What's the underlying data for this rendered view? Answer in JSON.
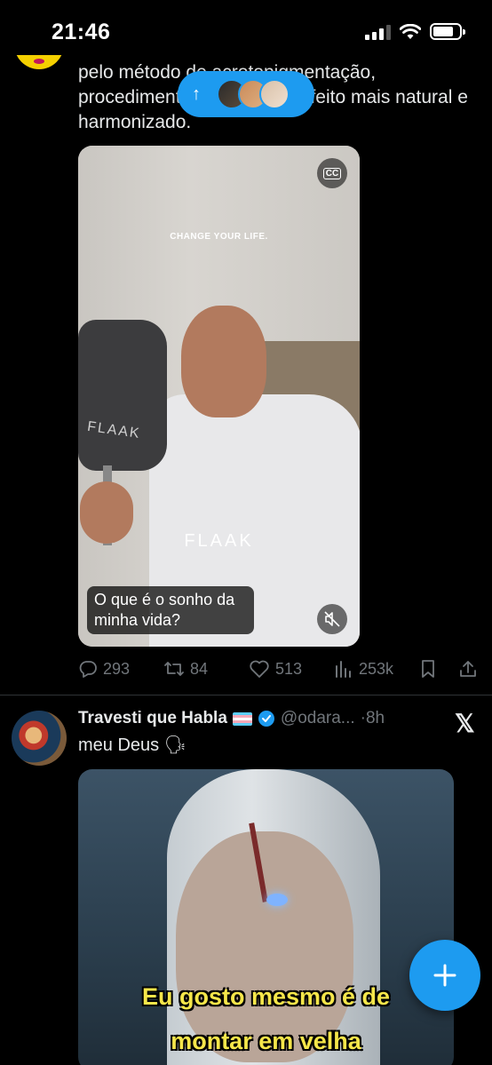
{
  "status_bar": {
    "time": "21:46",
    "signal_icon": "signal-icon",
    "wifi_icon": "wifi-icon",
    "battery_icon": "battery-icon"
  },
  "new_posts_pill": {
    "icon": "arrow-up-icon"
  },
  "tweet1": {
    "text": "pelo método de acrotopigmentação, procedimento que traz um efeito mais natural e harmonizado.",
    "video": {
      "tagline": "CHANGE YOUR LIFE.",
      "brand": "FLAAK",
      "mirror_brand": "FLAAK",
      "caption": "O que é o sonho da minha vida?",
      "cc_label": "CC"
    },
    "actions": {
      "replies": "293",
      "reposts": "84",
      "likes": "513",
      "views": "253k"
    }
  },
  "tweet2": {
    "name": "Travesti que Habla",
    "handle": "@odara...",
    "time": "·8h",
    "text": "meu Deus 🗣",
    "meme_line1": "Eu gosto mesmo é de",
    "meme_line2": "montar em velha"
  },
  "colors": {
    "accent": "#1d9bf0",
    "background": "#000000",
    "muted": "#71767b",
    "text": "#e7e9ea"
  }
}
